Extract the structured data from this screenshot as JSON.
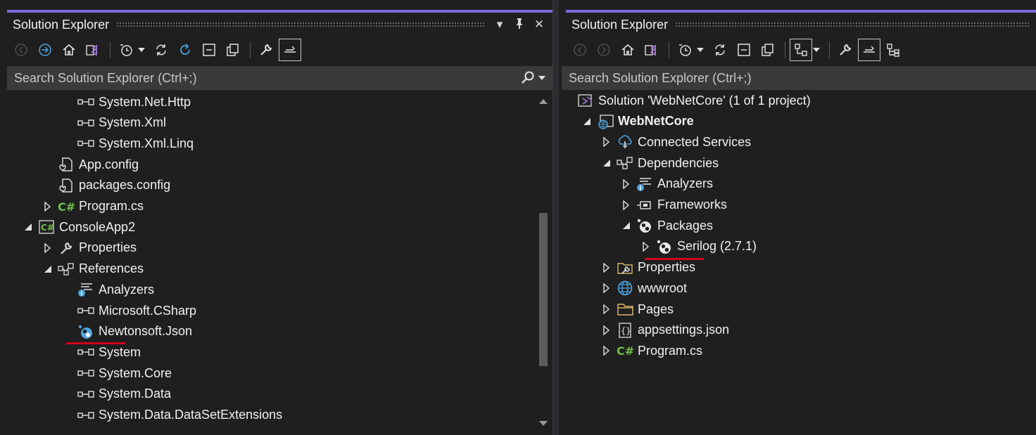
{
  "left": {
    "title": "Solution Explorer",
    "search_placeholder": "Search Solution Explorer (Ctrl+;)",
    "tree": [
      {
        "label": "System.Net.Http",
        "icon": "reference-icon",
        "level": 3,
        "expander": "none"
      },
      {
        "label": "System.Xml",
        "icon": "reference-icon",
        "level": 3,
        "expander": "none"
      },
      {
        "label": "System.Xml.Linq",
        "icon": "reference-icon",
        "level": 3,
        "expander": "none"
      },
      {
        "label": "App.config",
        "icon": "config-file-icon",
        "level": 2,
        "expander": "none"
      },
      {
        "label": "packages.config",
        "icon": "config-file-icon",
        "level": 2,
        "expander": "none"
      },
      {
        "label": "Program.cs",
        "icon": "csharp-file-icon",
        "level": 2,
        "expander": "collapsed"
      },
      {
        "label": "ConsoleApp2",
        "icon": "csharp-project-icon",
        "level": 1,
        "expander": "expanded"
      },
      {
        "label": "Properties",
        "icon": "wrench-icon",
        "level": 2,
        "expander": "collapsed"
      },
      {
        "label": "References",
        "icon": "references-icon",
        "level": 2,
        "expander": "expanded"
      },
      {
        "label": "Analyzers",
        "icon": "analyzers-icon",
        "level": 3,
        "expander": "none"
      },
      {
        "label": "Microsoft.CSharp",
        "icon": "reference-icon",
        "level": 3,
        "expander": "none"
      },
      {
        "label": "Newtonsoft.Json",
        "icon": "package-icon",
        "level": 3,
        "expander": "none",
        "underlined": true
      },
      {
        "label": "System",
        "icon": "reference-icon",
        "level": 3,
        "expander": "none"
      },
      {
        "label": "System.Core",
        "icon": "reference-icon",
        "level": 3,
        "expander": "none"
      },
      {
        "label": "System.Data",
        "icon": "reference-icon",
        "level": 3,
        "expander": "none"
      },
      {
        "label": "System.Data.DataSetExtensions",
        "icon": "reference-icon",
        "level": 3,
        "expander": "none"
      }
    ]
  },
  "right": {
    "title": "Solution Explorer",
    "search_placeholder": "Search Solution Explorer (Ctrl+;)",
    "tree": [
      {
        "label": "Solution 'WebNetCore' (1 of 1 project)",
        "icon": "solution-icon",
        "level": 0,
        "expander": "none"
      },
      {
        "label": "WebNetCore",
        "icon": "web-project-icon",
        "level": 1,
        "expander": "expanded",
        "bold": true
      },
      {
        "label": "Connected Services",
        "icon": "connected-services-icon",
        "level": 2,
        "expander": "collapsed"
      },
      {
        "label": "Dependencies",
        "icon": "references-icon",
        "level": 2,
        "expander": "expanded"
      },
      {
        "label": "Analyzers",
        "icon": "analyzers-icon",
        "level": 3,
        "expander": "collapsed"
      },
      {
        "label": "Frameworks",
        "icon": "framework-icon",
        "level": 3,
        "expander": "collapsed"
      },
      {
        "label": "Packages",
        "icon": "package-icon",
        "level": 3,
        "expander": "expanded"
      },
      {
        "label": "Serilog (2.7.1)",
        "icon": "package-icon",
        "level": 4,
        "expander": "collapsed",
        "underlined": true
      },
      {
        "label": "Properties",
        "icon": "properties-folder-icon",
        "level": 2,
        "expander": "collapsed"
      },
      {
        "label": "wwwroot",
        "icon": "globe-icon",
        "level": 2,
        "expander": "collapsed"
      },
      {
        "label": "Pages",
        "icon": "folder-icon",
        "level": 2,
        "expander": "collapsed"
      },
      {
        "label": "appsettings.json",
        "icon": "json-file-icon",
        "level": 2,
        "expander": "collapsed"
      },
      {
        "label": "Program.cs",
        "icon": "csharp-file-icon",
        "level": 2,
        "expander": "collapsed"
      }
    ]
  },
  "colors": {
    "accent": "#7b6ad9",
    "csharp": "#6fbf4a",
    "blue_icon": "#4fa3e0",
    "underline": "#d0021b"
  }
}
